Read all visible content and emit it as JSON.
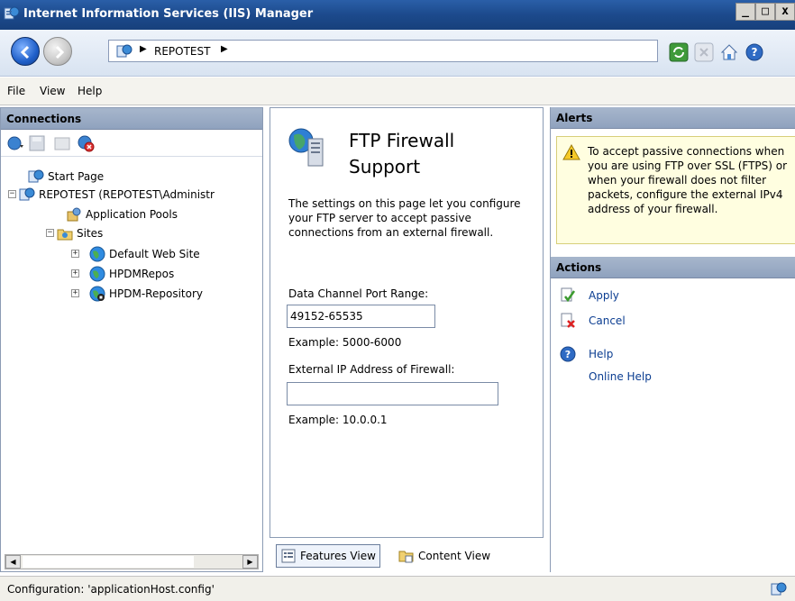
{
  "window": {
    "title": "Internet Information Services (IIS) Manager",
    "controls": [
      "_",
      "□",
      "x"
    ]
  },
  "addressbar": {
    "breadcrumb": "REPOTEST",
    "toolbar_icons": [
      "refresh-icon",
      "stop-icon",
      "home-icon",
      "help-icon"
    ]
  },
  "menu": {
    "file": "File",
    "view": "View",
    "help": "Help"
  },
  "connections": {
    "header": "Connections",
    "tree": [
      {
        "label": "Start Page"
      },
      {
        "label": "REPOTEST (REPOTEST\\Administr"
      },
      {
        "label": "Application Pools"
      },
      {
        "label": "Sites"
      },
      {
        "label": "Default Web Site"
      },
      {
        "label": "HPDMRepos"
      },
      {
        "label": "HPDM-Repository"
      }
    ]
  },
  "feature": {
    "title_line1": "FTP Firewall",
    "title_line2": "Support",
    "description": "The settings on this page let you configure your FTP server to accept passive connections from an external firewall.",
    "port_range_label": "Data Channel Port Range:",
    "port_range_value": "49152-65535",
    "port_example": "Example: 5000-6000",
    "external_ip_label": "External IP Address of Firewall:",
    "external_ip_value": "",
    "ip_example": "Example: 10.0.0.1"
  },
  "views": {
    "features_view": "Features View",
    "content_view": "Content View"
  },
  "alerts": {
    "header": "Alerts",
    "message": "To accept passive connections when you are using FTP over SSL (FTPS) or when your firewall does not filter packets, configure the external IPv4 address of your firewall."
  },
  "actions": {
    "header": "Actions",
    "apply": "Apply",
    "cancel": "Cancel",
    "help": "Help",
    "online_help": "Online Help"
  },
  "status": {
    "text": "Configuration: 'applicationHost.config'"
  },
  "colors": {
    "title_bar": "#1c4a8c",
    "panel_header": "#9aabc4",
    "link": "#0b3d91",
    "alert_bg": "#fffee0"
  }
}
